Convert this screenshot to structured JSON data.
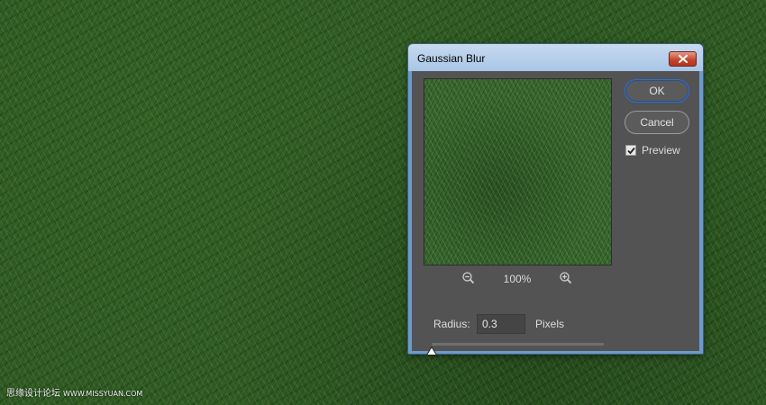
{
  "dialog": {
    "title": "Gaussian Blur",
    "ok_label": "OK",
    "cancel_label": "Cancel",
    "preview_label": "Preview",
    "preview_checked": true,
    "zoom_level": "100%",
    "radius_label": "Radius:",
    "radius_value": "0.3",
    "radius_unit": "Pixels",
    "slider_fraction": 0.0,
    "close_icon": "close-icon",
    "zoom_out_icon": "zoom-out-icon",
    "zoom_in_icon": "zoom-in-icon"
  },
  "watermark": {
    "chinese": "思缘设计论坛",
    "url": "WWW.MISSYUAN.COM"
  },
  "colors": {
    "panel": "#535353",
    "titlebar": "#b8d0ec",
    "close_button": "#c5412a",
    "ok_border": "#2f6fd1"
  }
}
